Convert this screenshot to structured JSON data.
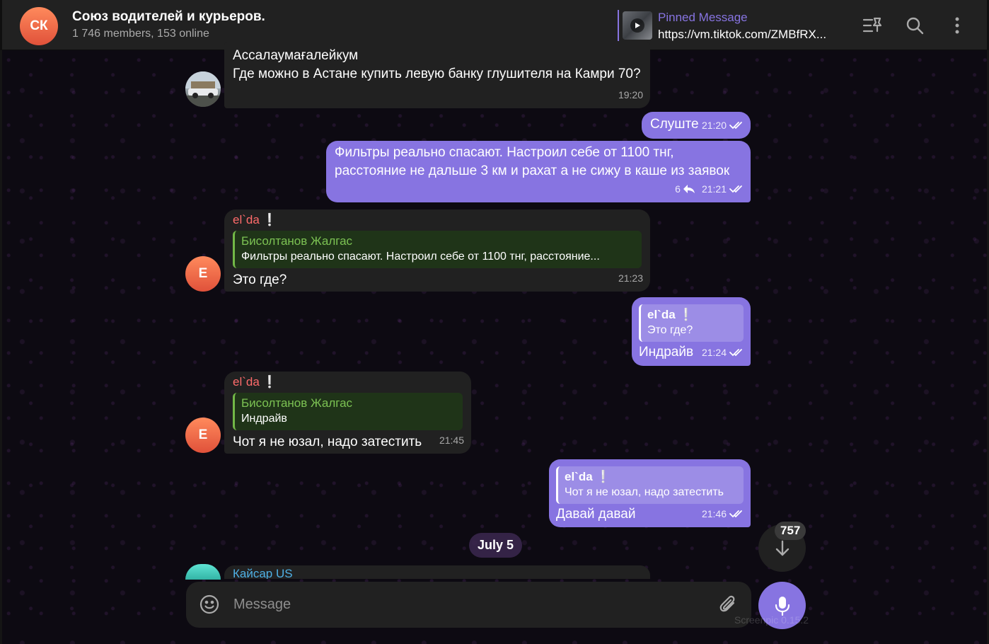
{
  "header": {
    "avatar_initials": "СК",
    "title": "Союз водителей и курьеров.",
    "subtitle": "1 746 members, 153 online",
    "pinned_label": "Pinned Message",
    "pinned_text": "https://vm.tiktok.com/ZMBfRX..."
  },
  "messages": {
    "m1": {
      "text": "Ассалаумағалейкум\nГде можно в Астане купить левую банку глушителя на Камри 70?",
      "time": "19:20"
    },
    "m2": {
      "text": "Слуште",
      "time": "21:20"
    },
    "m3": {
      "text": "Фильтры реально спасают. Настроил себе от 1100 тнг, расстояние не дальше 3 км и рахат а не сижу в каше из заявок",
      "replies": "6",
      "time": "21:21"
    },
    "m4": {
      "avatar": "E",
      "sender": "el`da",
      "sender_mark": "❕",
      "reply_name": "Бисолтанов Жалгас",
      "reply_text": "Фильтры реально спасают. Настроил себе от 1100 тнг, расстояние...",
      "text": "Это где?",
      "time": "21:23"
    },
    "m5": {
      "reply_name": "el`da ❕",
      "reply_text": "Это где?",
      "text": "Индрайв",
      "time": "21:24"
    },
    "m6": {
      "avatar": "E",
      "sender": "el`da",
      "sender_mark": "❕",
      "reply_name": "Бисолтанов Жалгас",
      "reply_text": "Индрайв",
      "text": "Чот я не юзал, надо затестить",
      "time": "21:45"
    },
    "m7": {
      "reply_name": "el`da ❕",
      "reply_text": "Чот я не юзал, надо затестить",
      "text": "Давай давай",
      "time": "21:46"
    },
    "m8": {
      "sender": "Кайсар US"
    }
  },
  "date_separator": "July 5",
  "unread_count": "757",
  "composer": {
    "placeholder": "Message"
  },
  "watermark": "Screenpic 0.15.2",
  "colors": {
    "accent": "#8774e1",
    "incoming": "#212121",
    "reply_green": "#7cc253",
    "sender_red": "#ff6b6b"
  }
}
